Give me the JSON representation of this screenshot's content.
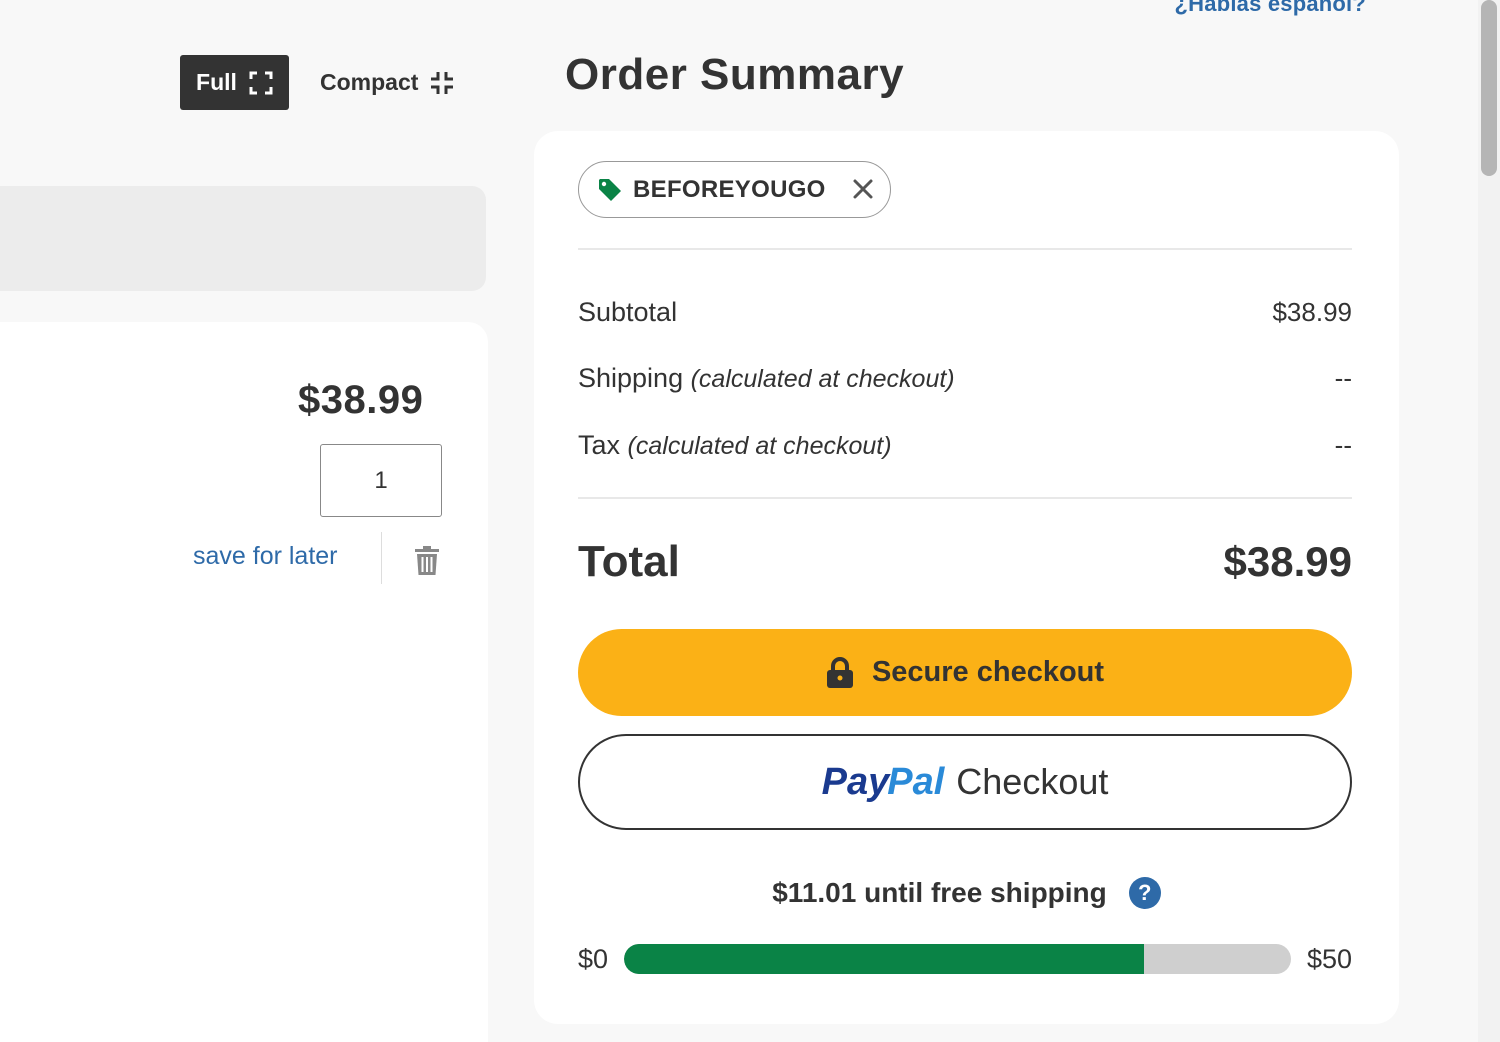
{
  "header": {
    "language_link": "¿Hablas español?"
  },
  "view_toggle": {
    "full_label": "Full",
    "compact_label": "Compact"
  },
  "cart_item": {
    "price": "$38.99",
    "quantity": "1",
    "save_for_later": "save for later"
  },
  "summary": {
    "title": "Order Summary",
    "promo_code": "BEFOREYOUGO",
    "rows": {
      "subtotal_label": "Subtotal",
      "subtotal_value": "$38.99",
      "shipping_label": "Shipping",
      "shipping_note": "(calculated at checkout)",
      "shipping_value": "--",
      "tax_label": "Tax",
      "tax_note": "(calculated at checkout)",
      "tax_value": "--"
    },
    "total_label": "Total",
    "total_value": "$38.99",
    "secure_checkout_label": "Secure checkout",
    "paypal_brand_pay": "Pay",
    "paypal_brand_pal": "Pal",
    "paypal_checkout_label": "Checkout",
    "free_shipping": {
      "message": "$11.01 until free shipping",
      "help_glyph": "?",
      "min_label": "$0",
      "max_label": "$50",
      "progress_fraction": 0.7798
    }
  },
  "colors": {
    "accent_yellow": "#fbb116",
    "progress_green": "#0a8346",
    "link_blue": "#2e6aa8",
    "promo_tag_green": "#0a8346",
    "paypal_dark_blue": "#1a3a8f",
    "paypal_light_blue": "#2a8ad8"
  },
  "icons": {
    "full": "expand-icon",
    "compact": "compress-icon",
    "delete": "trash-icon",
    "promo": "tag-icon",
    "remove_promo": "close-icon",
    "checkout": "lock-icon",
    "help": "question-icon"
  }
}
